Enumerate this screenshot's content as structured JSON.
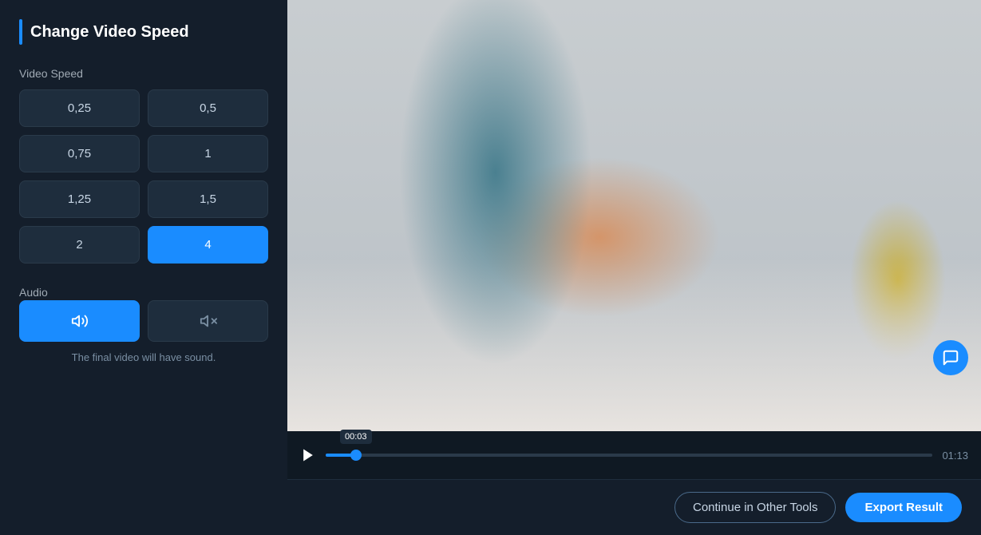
{
  "page": {
    "title": "Change Video Speed"
  },
  "left_panel": {
    "title": "Change Video Speed",
    "video_speed_label": "Video Speed",
    "speed_options": [
      {
        "value": "0,25",
        "id": "s025",
        "active": false
      },
      {
        "value": "0,5",
        "id": "s05",
        "active": false
      },
      {
        "value": "0,75",
        "id": "s075",
        "active": false
      },
      {
        "value": "1",
        "id": "s1",
        "active": false
      },
      {
        "value": "1,25",
        "id": "s125",
        "active": false
      },
      {
        "value": "1,5",
        "id": "s15",
        "active": false
      },
      {
        "value": "2",
        "id": "s2",
        "active": false
      },
      {
        "value": "4",
        "id": "s4",
        "active": true
      }
    ],
    "audio_label": "Audio",
    "audio_options": [
      {
        "id": "sound-on",
        "active": true
      },
      {
        "id": "sound-off",
        "active": false
      }
    ],
    "audio_note": "The final video will have sound."
  },
  "video_player": {
    "time_tooltip": "00:03",
    "time_total": "01:13",
    "progress_pct": 5
  },
  "bottom_bar": {
    "continue_label": "Continue in Other Tools",
    "export_label": "Export Result"
  }
}
